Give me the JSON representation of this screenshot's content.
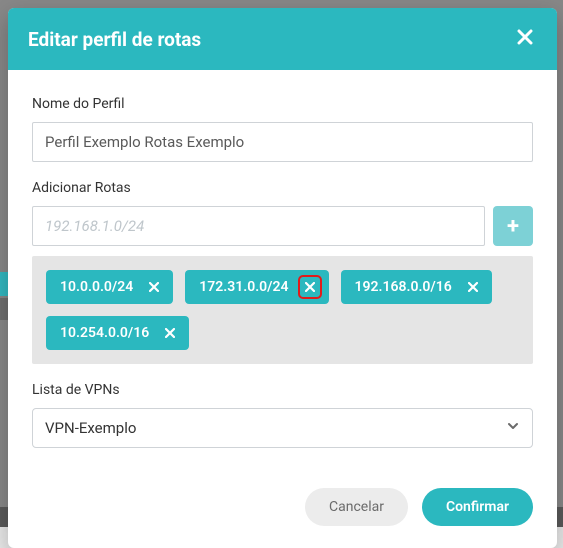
{
  "header": {
    "title": "Editar perfil de rotas"
  },
  "profile_name": {
    "label": "Nome do Perfil",
    "value": "Perfil Exemplo Rotas Exemplo"
  },
  "add_routes": {
    "label": "Adicionar Rotas",
    "placeholder": "192.168.1.0/24",
    "add_icon_text": "+"
  },
  "routes": [
    {
      "cidr": "10.0.0.0/24",
      "highlight": false
    },
    {
      "cidr": "172.31.0.0/24",
      "highlight": true
    },
    {
      "cidr": "192.168.0.0/16",
      "highlight": false
    },
    {
      "cidr": "10.254.0.0/16",
      "highlight": false
    }
  ],
  "vpn_list": {
    "label": "Lista de VPNs",
    "selected": "VPN-Exemplo"
  },
  "footer": {
    "cancel": "Cancelar",
    "confirm": "Confirmar"
  }
}
